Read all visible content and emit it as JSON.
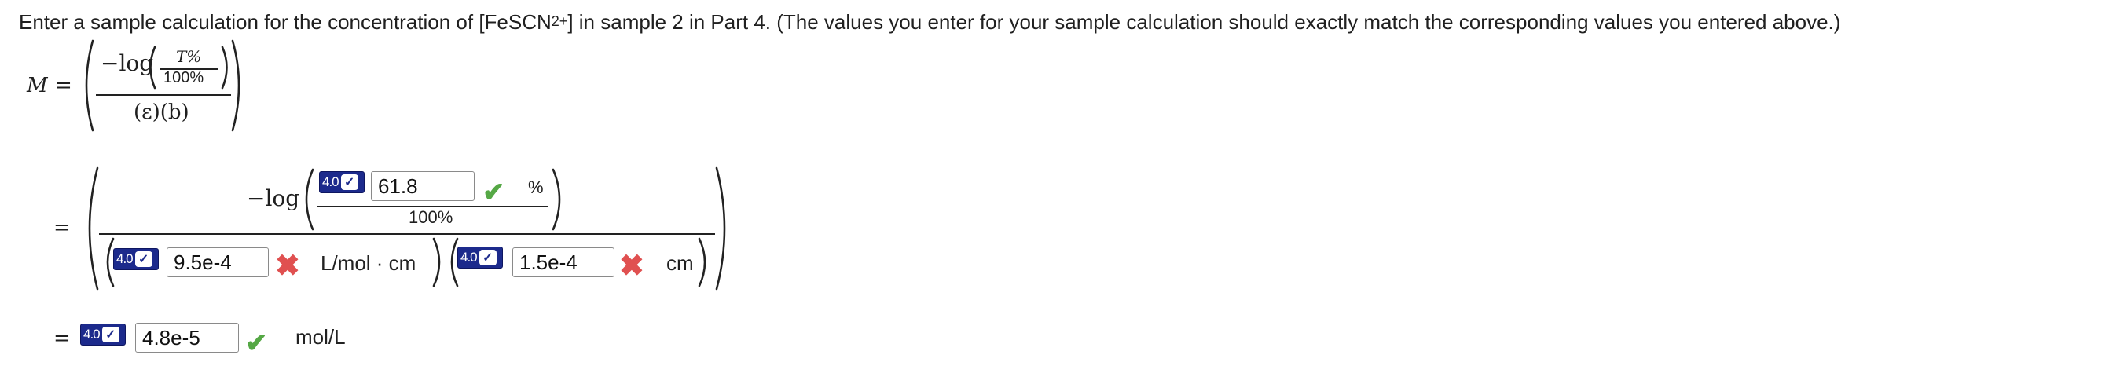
{
  "prompt": {
    "before": "Enter a sample calculation for the concentration of [FeSCN",
    "sup": "2+",
    "after": "] in sample 2 in Part 4. (The values you enter for your sample calculation should exactly match the corresponding values you entered above.)"
  },
  "formula": {
    "lhs": "M",
    "eq": "=",
    "neglog": "−log",
    "t_percent": "T%",
    "hundred_percent": "100%",
    "eps_b": "(ε)(b)"
  },
  "row2": {
    "eq": "=",
    "neglog": "−log",
    "hundred_percent": "100%",
    "t_input": {
      "value": "61.8",
      "unit": "%",
      "status": "correct"
    },
    "eps_input": {
      "value": "9.5e-4",
      "unit": "L/mol · cm",
      "status": "incorrect"
    },
    "b_input": {
      "value": "1.5e-4",
      "unit": "cm",
      "status": "incorrect"
    }
  },
  "row3": {
    "eq": "=",
    "result_input": {
      "value": "4.8e-5",
      "unit": "mol/L",
      "status": "correct"
    }
  },
  "badge": {
    "version_label": "4.0",
    "check_glyph": "✓",
    "color": "#1c2a8c"
  },
  "status_glyphs": {
    "correct": "✔",
    "incorrect": "✖"
  },
  "colors": {
    "correct": "#55a845",
    "incorrect": "#e05050"
  }
}
